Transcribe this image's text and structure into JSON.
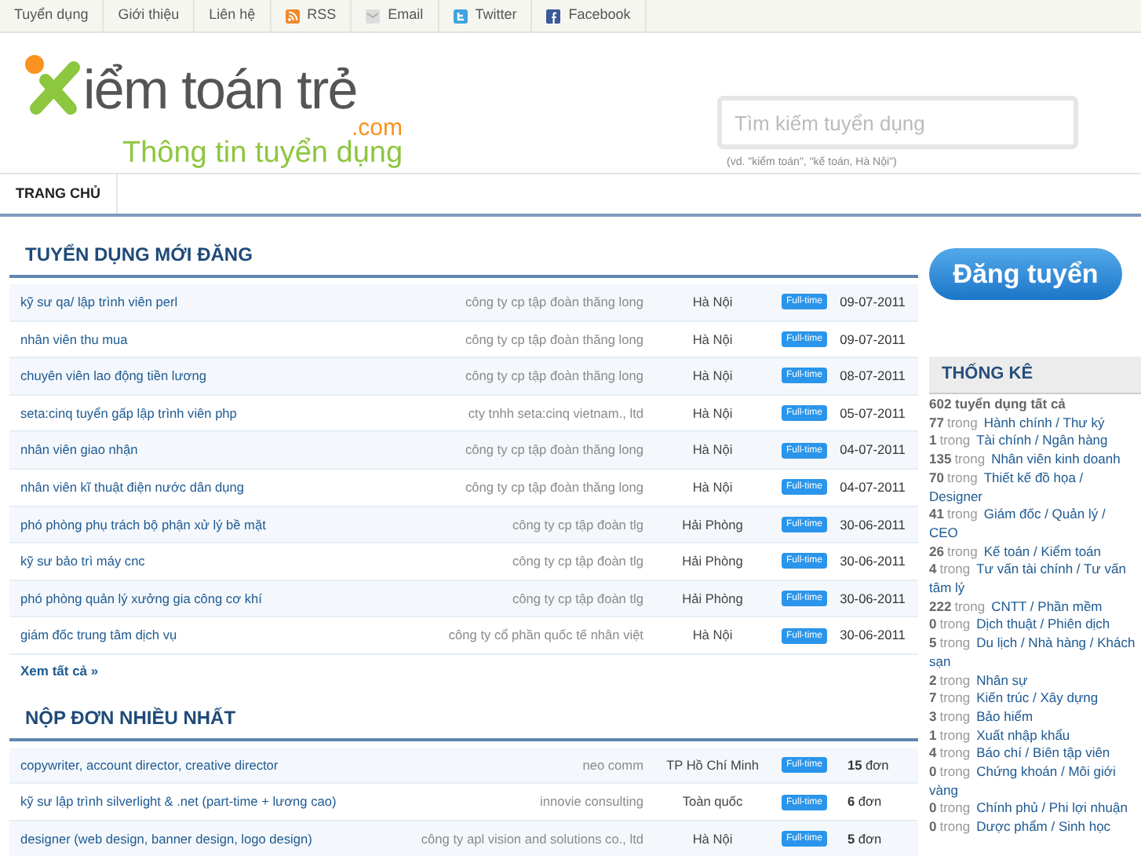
{
  "top_nav": [
    {
      "label": "Tuyển dụng",
      "kind": "text"
    },
    {
      "label": "Giới thiệu",
      "kind": "text"
    },
    {
      "label": "Liên hệ",
      "kind": "text"
    },
    {
      "label": "RSS",
      "kind": "rss"
    },
    {
      "label": "Email",
      "kind": "email"
    },
    {
      "label": "Twitter",
      "kind": "twitter"
    },
    {
      "label": "Facebook",
      "kind": "facebook"
    }
  ],
  "logo": {
    "text": "iểm toán trẻ",
    "suffix": ".com",
    "tagline": "Thông tin tuyển dụng"
  },
  "search": {
    "placeholder": "Tìm kiếm tuyển dụng",
    "hint": "(vd. \"kiểm toán\", \"kế toán, Hà Nội\")"
  },
  "main_nav": [
    {
      "label": "TRANG CHỦ",
      "selected": true
    }
  ],
  "sections": [
    {
      "title": "TUYỂN DỤNG MỚI ĐĂNG",
      "kind": "date",
      "rows": [
        {
          "title": "kỹ sư qa/ lập trình viên perl",
          "company": "công ty cp tập đoàn thăng long",
          "location": "Hà Nội",
          "badge": "Full-time",
          "value": "09-07-2011"
        },
        {
          "title": "nhân viên thu mua",
          "company": "công ty cp tập đoàn thăng long",
          "location": "Hà Nội",
          "badge": "Full-time",
          "value": "09-07-2011"
        },
        {
          "title": "chuyên viên lao động tiền lương",
          "company": "công ty cp tập đoàn thăng long",
          "location": "Hà Nội",
          "badge": "Full-time",
          "value": "08-07-2011"
        },
        {
          "title": "seta:cinq tuyển gấp lập trình viên php",
          "company": "cty tnhh seta:cinq vietnam., ltd",
          "location": "Hà Nội",
          "badge": "Full-time",
          "value": "05-07-2011"
        },
        {
          "title": "nhân viên giao nhận",
          "company": "công ty cp tập đoàn thăng long",
          "location": "Hà Nội",
          "badge": "Full-time",
          "value": "04-07-2011"
        },
        {
          "title": "nhân viên kĩ thuật điện nước dân dụng",
          "company": "công ty cp tập đoàn thăng long",
          "location": "Hà Nội",
          "badge": "Full-time",
          "value": "04-07-2011"
        },
        {
          "title": "phó phòng phụ trách bộ phận xử lý bề mặt",
          "company": "công ty cp tập đoàn tlg",
          "location": "Hải Phòng",
          "badge": "Full-time",
          "value": "30-06-2011"
        },
        {
          "title": "kỹ sư bảo trì máy cnc",
          "company": "công ty cp tập đoàn tlg",
          "location": "Hải Phòng",
          "badge": "Full-time",
          "value": "30-06-2011"
        },
        {
          "title": "phó phòng quản lý xưởng gia công cơ khí",
          "company": "công ty cp tập đoàn tlg",
          "location": "Hải Phòng",
          "badge": "Full-time",
          "value": "30-06-2011"
        },
        {
          "title": "giám đốc trung tâm dịch vụ",
          "company": "công ty cổ phần quốc tế nhân việt",
          "location": "Hà Nội",
          "badge": "Full-time",
          "value": "30-06-2011"
        }
      ],
      "more": "Xem tất cả »"
    },
    {
      "title": "NỘP ĐƠN NHIỀU NHẤT",
      "kind": "count",
      "rows": [
        {
          "title": "copywriter, account director, creative director",
          "company": "neo comm",
          "location": "TP Hồ Chí Minh",
          "badge": "Full-time",
          "value": "**15** đơn"
        },
        {
          "title": "kỹ sư lập trình silverlight & .net (part-time + lương cao)",
          "company": "innovie consulting",
          "location": "Toàn quốc",
          "badge": "Full-time",
          "value": "**6** đơn"
        },
        {
          "title": "designer (web design, banner design, logo design)",
          "company": "công ty apl vision and solutions co., ltd",
          "location": "Hà Nội",
          "badge": "Full-time",
          "value": "**5** đơn"
        }
      ]
    }
  ],
  "post_button": "Đăng tuyển",
  "stats": {
    "title": "THỐNG KÊ",
    "total": "602 tuyển dụng tất cả",
    "items": [
      {
        "count": "77",
        "sep": "trong",
        "category": [
          "Hành chính / Thư ký"
        ]
      },
      {
        "count": "1",
        "sep": "trong",
        "category": [
          "Tài chính / Ngân hàng"
        ]
      },
      {
        "count": "135",
        "sep": "trong",
        "category": [
          "Nhân viên kinh doanh"
        ]
      },
      {
        "count": "70",
        "sep": "trong",
        "category": [
          "Thiết kế đồ họa /",
          "Designer"
        ]
      },
      {
        "count": "41",
        "sep": "trong",
        "category": [
          "Giám đốc / Quản lý /",
          "CEO"
        ]
      },
      {
        "count": "26",
        "sep": "trong",
        "category": [
          "Kế toán / Kiểm toán"
        ]
      },
      {
        "count": "4",
        "sep": "trong",
        "category": [
          "Tư vấn tài chính / Tư vấn",
          "tâm lý"
        ]
      },
      {
        "count": "222",
        "sep": "trong",
        "category": [
          "CNTT / Phần mềm"
        ]
      },
      {
        "count": "0",
        "sep": "trong",
        "category": [
          "Dịch thuật / Phiên dịch"
        ]
      },
      {
        "count": "5",
        "sep": "trong",
        "category": [
          "Du lịch / Nhà hàng / Khách",
          "sạn"
        ]
      },
      {
        "count": "2",
        "sep": "trong",
        "category": [
          "Nhân sự"
        ]
      },
      {
        "count": "7",
        "sep": "trong",
        "category": [
          "Kiến trúc / Xây dựng"
        ]
      },
      {
        "count": "3",
        "sep": "trong",
        "category": [
          "Bảo hiểm"
        ]
      },
      {
        "count": "1",
        "sep": "trong",
        "category": [
          "Xuất nhập khẩu"
        ]
      },
      {
        "count": "4",
        "sep": "trong",
        "category": [
          "Báo chí / Biên tập viên"
        ]
      },
      {
        "count": "0",
        "sep": "trong",
        "category": [
          "Chứng khoán / Môi giới",
          "vàng"
        ]
      },
      {
        "count": "0",
        "sep": "trong",
        "category": [
          "Chính phủ / Phi lợi nhuận"
        ]
      },
      {
        "count": "0",
        "sep": "trong",
        "category": [
          "Dược phẩm / Sinh học"
        ]
      }
    ]
  }
}
